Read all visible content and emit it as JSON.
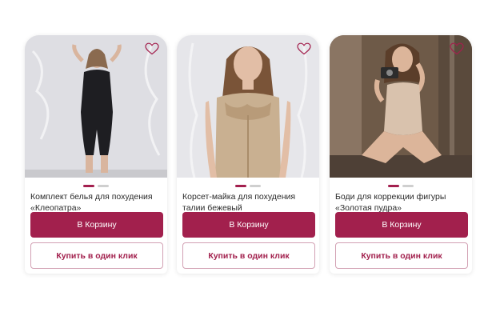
{
  "colors": {
    "accent": "#a2204d",
    "dot_inactive": "#cfcfcf",
    "outline_border": "#d2a1b3"
  },
  "products": [
    {
      "title": "Комплект белья для похудения «Клеопатра»",
      "cart_label": "В Корзину",
      "one_click_label": "Купить в один клик",
      "favorite_icon": "heart-outline-icon",
      "image_slides": 2,
      "active_slide": 1
    },
    {
      "title": "Корсет-майка для похудения талии бежевый",
      "cart_label": "В Корзину",
      "one_click_label": "Купить в один клик",
      "favorite_icon": "heart-outline-icon",
      "image_slides": 2,
      "active_slide": 1
    },
    {
      "title": "Боди для коррекции фигуры «Золотая пудра»",
      "cart_label": "В Корзину",
      "one_click_label": "Купить в один клик",
      "favorite_icon": "heart-outline-icon",
      "image_slides": 2,
      "active_slide": 1
    }
  ]
}
